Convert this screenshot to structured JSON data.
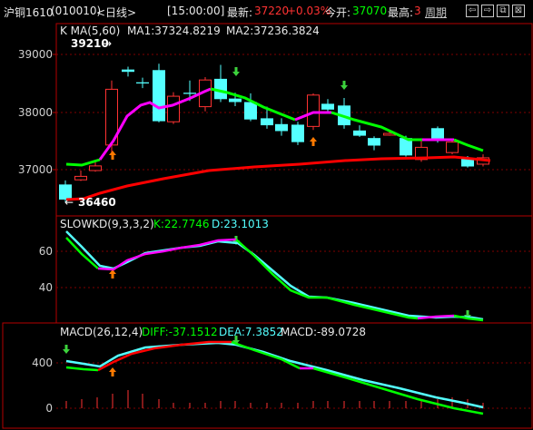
{
  "topbar": {
    "instrument": "沪铜1610",
    "code": "(010010)",
    "period": "<日线>",
    "time": "[15:00:00]",
    "last_label": "最新:",
    "last_value": "37220",
    "change": "+0.03%",
    "open_label": "今开:",
    "open_value": "37070",
    "high_label": "最高:",
    "high_value": "3",
    "period_button": "周期"
  },
  "price_panel": {
    "indicator_label": "K  MA(5,60)",
    "ma1_label": "MA1:37324.8219",
    "ma2_label": "MA2:37236.3824",
    "high_marker": "39210",
    "low_marker": "36460",
    "y_ticks": [
      "39000",
      "38000",
      "37000"
    ]
  },
  "kd_panel": {
    "indicator_label": "SLOWKD(9,3,3,2)",
    "k_label": "K:22.7746",
    "d_label": "D:23.1013",
    "y_ticks": [
      "60",
      "40"
    ]
  },
  "macd_panel": {
    "indicator_label": "MACD(26,12,4)",
    "diff_label": "DIFF:-37.1512",
    "dea_label": "DEA:7.3852",
    "macd_label": "MACD:-89.0728",
    "y_ticks": [
      "400",
      "0"
    ]
  },
  "colors": {
    "up": "#ff3232",
    "down": "#54ffff",
    "ma1_green": "#00ff00",
    "ma1_magenta": "#ff00ff",
    "ma2": "#ff0000",
    "panel_border": "#b40000",
    "grid": "#7f0000"
  }
}
